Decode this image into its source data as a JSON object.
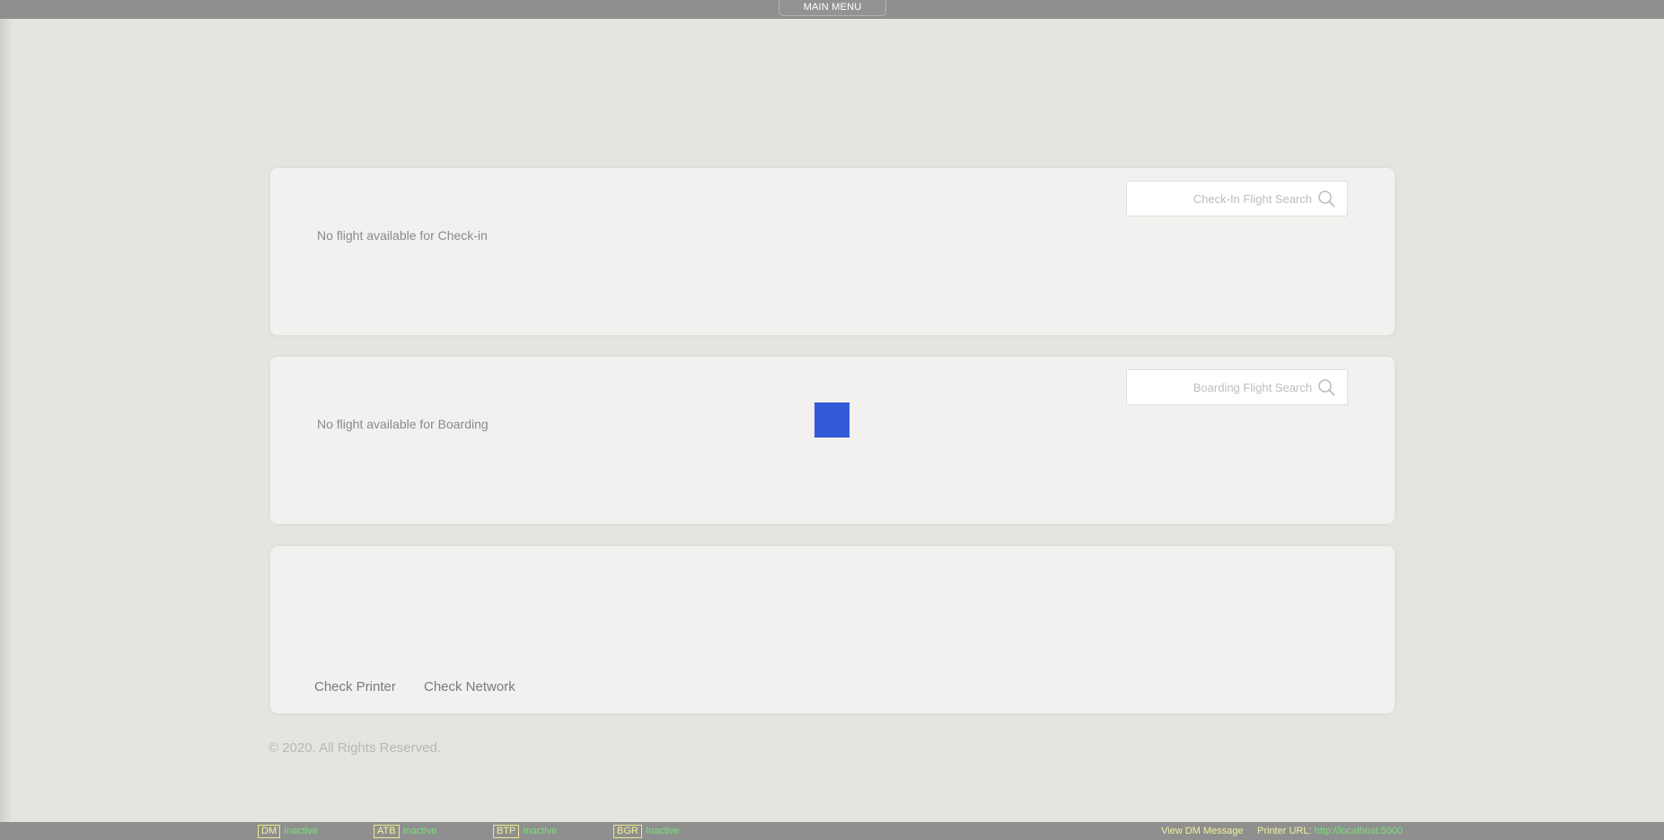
{
  "top_bar": {
    "main_menu_label": "MAIN MENU"
  },
  "checkin": {
    "message": "No flight available for Check-in",
    "search_placeholder": "Check-In Flight Search"
  },
  "boarding": {
    "message": "No flight available for Boarding",
    "search_placeholder": "Boarding Flight Search"
  },
  "tools": {
    "check_printer_label": "Check Printer",
    "check_network_label": "Check Network"
  },
  "footer": {
    "copyright": "© 2020. All Rights Reserved."
  },
  "status_bar": {
    "items": [
      {
        "tag": "DM",
        "status": "Inactive"
      },
      {
        "tag": "ATB",
        "status": "Inactive"
      },
      {
        "tag": "BTP",
        "status": "Inactive"
      },
      {
        "tag": "BGR",
        "status": "Inactive"
      }
    ],
    "view_dm_label": "View DM Message",
    "printer_url_label": "Printer URL:",
    "printer_url_value": "http://localhost:5000"
  },
  "colors": {
    "background": "#e5e4e0",
    "panel": "#f2f1ef",
    "bar": "#8f8f8f",
    "status_tag": "#f1f1a0",
    "status_value": "#7be07b",
    "loading_square": "#3359d9"
  },
  "icons": {
    "search": "search-icon"
  }
}
